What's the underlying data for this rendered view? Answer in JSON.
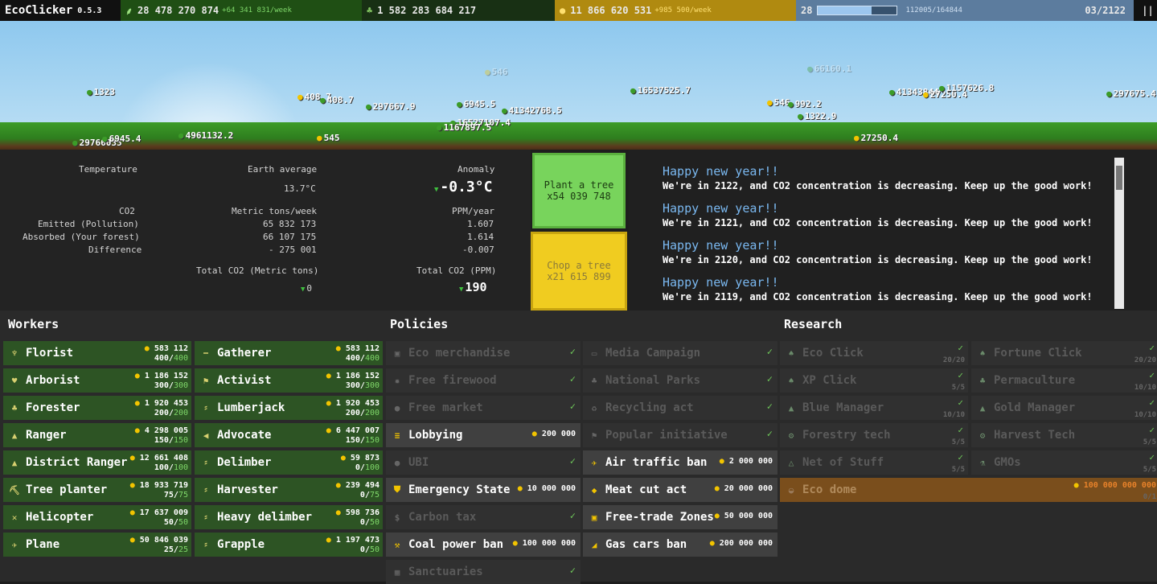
{
  "topbar": {
    "title": "EcoClicker",
    "version": "0.5.3",
    "co2_total": "28 478 270 874",
    "co2_rate": "+64 341 831/week",
    "trees": "1 582 283 684 217",
    "money": "11 866 620 531",
    "money_rate": "+985 500/week",
    "progress_level": "28",
    "progress_fraction": 0.68,
    "progress_text": "112005/164844",
    "date": "03/2122",
    "pause": "||"
  },
  "floats": [
    {
      "t": "1323",
      "k": "d"
    },
    {
      "t": "408.7",
      "k": "c"
    },
    {
      "t": "408.7",
      "k": "d"
    },
    {
      "t": "297667.9",
      "k": "d"
    },
    {
      "t": "6945.5",
      "k": "d"
    },
    {
      "t": "16527107.4",
      "k": "d"
    },
    {
      "t": "41342768.5",
      "k": "d"
    },
    {
      "t": "1167897.5",
      "k": "d"
    },
    {
      "t": "16537525.7",
      "k": "d"
    },
    {
      "t": "546",
      "k": "c"
    },
    {
      "t": "992.2",
      "k": "d"
    },
    {
      "t": "1322.9",
      "k": "d"
    },
    {
      "t": "41343844",
      "k": "d"
    },
    {
      "t": "27250.4",
      "k": "c"
    },
    {
      "t": "1157626.8",
      "k": "d"
    },
    {
      "t": "297675.4",
      "k": "d"
    },
    {
      "t": "29766035",
      "k": "d"
    },
    {
      "t": "6945.4",
      "k": "d"
    },
    {
      "t": "4961132.2",
      "k": "d"
    },
    {
      "t": "545",
      "k": "c"
    },
    {
      "t": "27250.4",
      "k": "c"
    },
    {
      "t": "546",
      "k": "c"
    },
    {
      "t": "66160.1",
      "k": "d"
    }
  ],
  "stats": {
    "temperature_label": "Temperature",
    "earth_avg_label": "Earth average",
    "earth_avg_value": "13.7°C",
    "anomaly_label": "Anomaly",
    "anomaly_value": "-0.3°C",
    "co2_label": "CO2",
    "emitted_label": "Emitted (Pollution)",
    "absorbed_label": "Absorbed (Your forest)",
    "difference_label": "Difference",
    "metric_header": "Metric tons/week",
    "ppm_header": "PPM/year",
    "emitted_tons": "65 832 173",
    "absorbed_tons": "66 107 175",
    "difference_tons": "- 275 001",
    "emitted_ppm": "1.607",
    "absorbed_ppm": "1.614",
    "difference_ppm": "-0.007",
    "total_tons_label": "Total CO2 (Metric tons)",
    "total_tons_value": "0",
    "total_ppm_label": "Total CO2 (PPM)",
    "total_ppm_value": "190"
  },
  "actions": {
    "plant_label": "Plant a tree",
    "plant_mult": "x54 039 748",
    "chop_label": "Chop a tree",
    "chop_mult": "x21 615 899"
  },
  "news": [
    {
      "h": "Happy new year!!",
      "b": "We're in 2122, and CO2 concentration is decreasing. Keep up the good work!"
    },
    {
      "h": "Happy new year!!",
      "b": "We're in 2121, and CO2 concentration is decreasing. Keep up the good work!"
    },
    {
      "h": "Happy new year!!",
      "b": "We're in 2120, and CO2 concentration is decreasing. Keep up the good work!"
    },
    {
      "h": "Happy new year!!",
      "b": "We're in 2119, and CO2 concentration is decreasing. Keep up the good work!"
    }
  ],
  "workers_title": "Workers",
  "workers": [
    {
      "name": "Florist",
      "icon": "flower-icon",
      "glyph": "♆",
      "price": "583 112",
      "count": "400",
      "max": "400"
    },
    {
      "name": "Gatherer",
      "icon": "rake-icon",
      "glyph": "⎯",
      "price": "583 112",
      "count": "400",
      "max": "400"
    },
    {
      "name": "Arborist",
      "icon": "sapling-icon",
      "glyph": "♥",
      "price": "1 186 152",
      "count": "300",
      "max": "300"
    },
    {
      "name": "Activist",
      "icon": "activist-icon",
      "glyph": "⚑",
      "price": "1 186 152",
      "count": "300",
      "max": "300"
    },
    {
      "name": "Forester",
      "icon": "tree-icon",
      "glyph": "♣",
      "price": "1 920 453",
      "count": "200",
      "max": "200"
    },
    {
      "name": "Lumberjack",
      "icon": "axe-icon",
      "glyph": "⸗",
      "price": "1 920 453",
      "count": "200",
      "max": "200"
    },
    {
      "name": "Ranger",
      "icon": "ranger-hat-icon",
      "glyph": "▲",
      "price": "4 298 005",
      "count": "150",
      "max": "150"
    },
    {
      "name": "Advocate",
      "icon": "megaphone-icon",
      "glyph": "◀",
      "price": "6 447 007",
      "count": "150",
      "max": "150"
    },
    {
      "name": "District Ranger",
      "icon": "ranger-hat-icon",
      "glyph": "▲",
      "price": "12 661 408",
      "count": "100",
      "max": "100"
    },
    {
      "name": "Delimber",
      "icon": "saw-icon",
      "glyph": "⸗",
      "price": "59 873",
      "count": "0",
      "max": "100"
    },
    {
      "name": "Tree planter",
      "icon": "planter-icon",
      "glyph": "⛏",
      "price": "18 933 719",
      "count": "75",
      "max": "75"
    },
    {
      "name": "Harvester",
      "icon": "harvester-icon",
      "glyph": "⸗",
      "price": "239 494",
      "count": "0",
      "max": "75"
    },
    {
      "name": "Helicopter",
      "icon": "helicopter-icon",
      "glyph": "✕",
      "price": "17 637 009",
      "count": "50",
      "max": "50"
    },
    {
      "name": "Heavy delimber",
      "icon": "heavy-saw-icon",
      "glyph": "⸗",
      "price": "598 736",
      "count": "0",
      "max": "50"
    },
    {
      "name": "Plane",
      "icon": "plane-icon",
      "glyph": "✈",
      "price": "50 846 039",
      "count": "25",
      "max": "25"
    },
    {
      "name": "Grapple",
      "icon": "grapple-icon",
      "glyph": "⸗",
      "price": "1 197 473",
      "count": "0",
      "max": "50"
    }
  ],
  "policies_title": "Policies",
  "policies": [
    {
      "name": "Eco merchandise",
      "icon": "shop-icon",
      "glyph": "▣",
      "state": "done",
      "cost": ""
    },
    {
      "name": "Media Campaign",
      "icon": "tv-icon",
      "glyph": "▭",
      "state": "done",
      "cost": ""
    },
    {
      "name": "Free firewood",
      "icon": "fire-icon",
      "glyph": "✹",
      "state": "done",
      "cost": ""
    },
    {
      "name": "National Parks",
      "icon": "park-icon",
      "glyph": "♣",
      "state": "done",
      "cost": ""
    },
    {
      "name": "Free market",
      "icon": "coins-icon",
      "glyph": "●",
      "state": "done",
      "cost": ""
    },
    {
      "name": "Recycling act",
      "icon": "recycle-icon",
      "glyph": "♻",
      "state": "done",
      "cost": ""
    },
    {
      "name": "Lobbying",
      "icon": "lobby-icon",
      "glyph": "≡",
      "state": "avail",
      "cost": "200 000"
    },
    {
      "name": "Popular initiative",
      "icon": "flag-icon",
      "glyph": "⚑",
      "state": "done",
      "cost": ""
    },
    {
      "name": "UBI",
      "icon": "ubi-icon",
      "glyph": "●",
      "state": "done",
      "cost": ""
    },
    {
      "name": "Air traffic ban",
      "icon": "plane-icon",
      "glyph": "✈",
      "state": "avail",
      "cost": "2 000 000"
    },
    {
      "name": "Emergency State",
      "icon": "shield-icon",
      "glyph": "⛊",
      "state": "avail",
      "cost": "10 000 000"
    },
    {
      "name": "Meat cut act",
      "icon": "meat-icon",
      "glyph": "◆",
      "state": "avail",
      "cost": "20 000 000"
    },
    {
      "name": "Carbon tax",
      "icon": "tax-icon",
      "glyph": "$",
      "state": "done",
      "cost": ""
    },
    {
      "name": "Free-trade Zones",
      "icon": "zone-icon",
      "glyph": "▣",
      "state": "avail",
      "cost": "50 000 000"
    },
    {
      "name": "Coal power ban",
      "icon": "coal-icon",
      "glyph": "⚒",
      "state": "avail",
      "cost": "100 000 000"
    },
    {
      "name": "Gas cars ban",
      "icon": "car-icon",
      "glyph": "◢",
      "state": "avail",
      "cost": "200 000 000"
    },
    {
      "name": "Sanctuaries",
      "icon": "sanctuary-icon",
      "glyph": "▦",
      "state": "done",
      "cost": ""
    }
  ],
  "research_title": "Research",
  "research": [
    {
      "name": "Eco Click",
      "icon": "leaf-icon",
      "glyph": "♠",
      "level": "20/20"
    },
    {
      "name": "Fortune Click",
      "icon": "coin-icon",
      "glyph": "♠",
      "level": "20/20"
    },
    {
      "name": "XP Click",
      "icon": "drop-icon",
      "glyph": "♠",
      "level": "5/5"
    },
    {
      "name": "Permaculture",
      "icon": "tree-icon",
      "glyph": "♣",
      "level": "10/10"
    },
    {
      "name": "Blue Manager",
      "icon": "blue-hat-icon",
      "glyph": "▲",
      "level": "10/10"
    },
    {
      "name": "Gold Manager",
      "icon": "gold-hat-icon",
      "glyph": "▲",
      "level": "10/10"
    },
    {
      "name": "Forestry tech",
      "icon": "gear-icon",
      "glyph": "⚙",
      "level": "5/5"
    },
    {
      "name": "Harvest Tech",
      "icon": "gear-icon",
      "glyph": "⚙",
      "level": "5/5"
    },
    {
      "name": "Net of Stuff",
      "icon": "network-icon",
      "glyph": "△",
      "level": "5/5"
    },
    {
      "name": "GMOs",
      "icon": "flask-icon",
      "glyph": "⚗",
      "level": "5/5"
    }
  ],
  "eco_dome": {
    "name": "Eco dome",
    "icon": "dome-icon",
    "glyph": "◒",
    "cost": "100 000 000 000",
    "level": "0/1"
  },
  "colors": {
    "accent_green": "#2d5424",
    "gold": "#f2c400",
    "news_heading": "#7ab8f0"
  }
}
